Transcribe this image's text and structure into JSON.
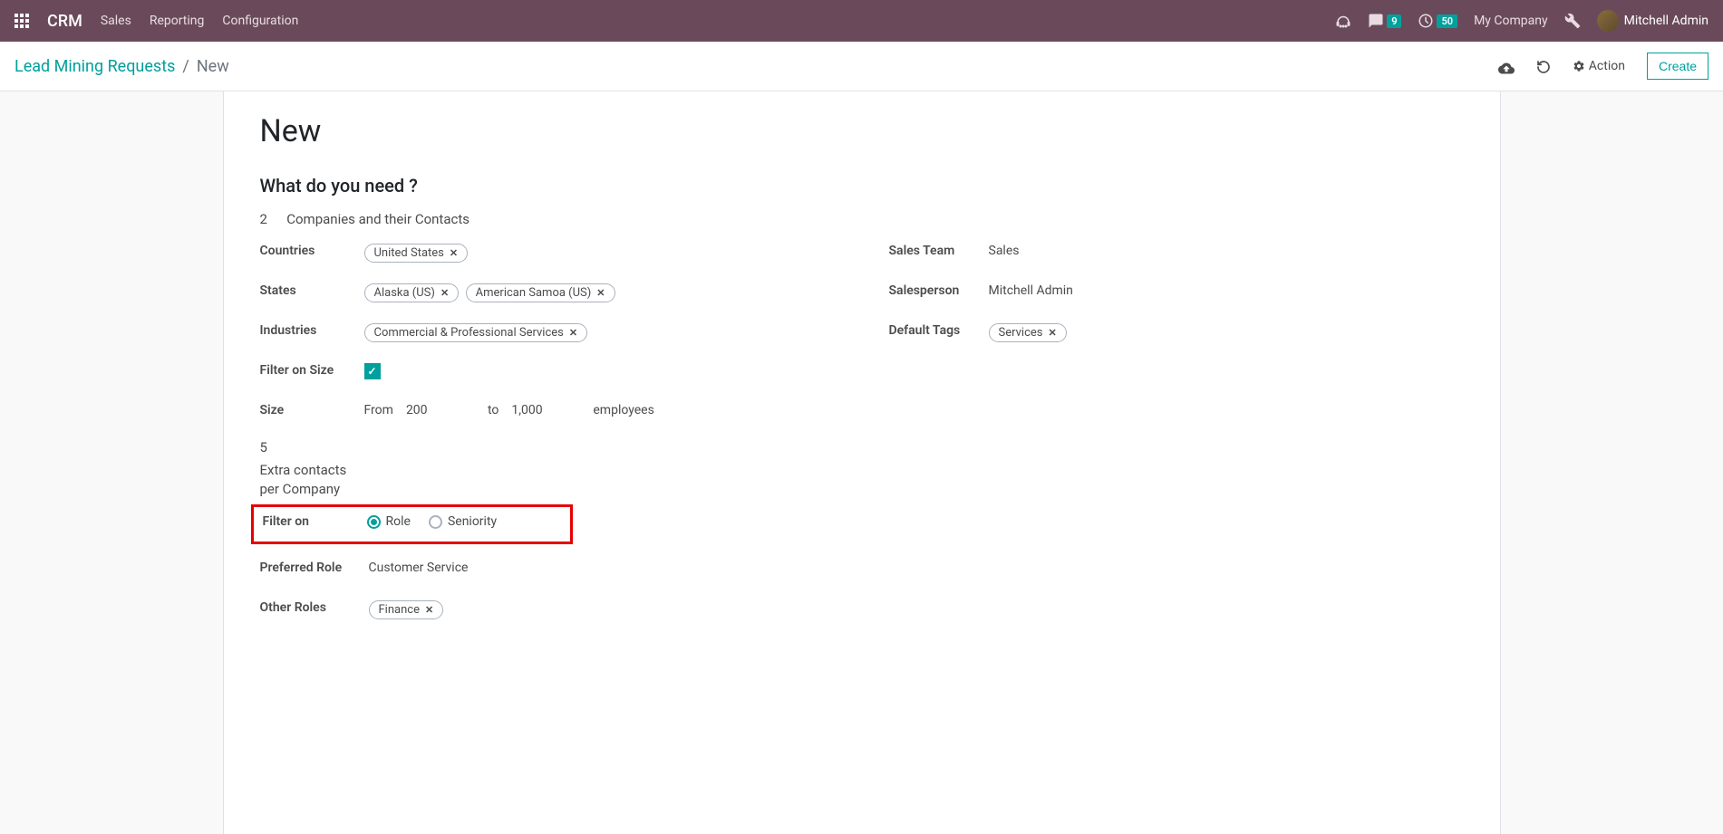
{
  "navbar": {
    "app_title": "CRM",
    "menu": [
      "Sales",
      "Reporting",
      "Configuration"
    ],
    "messages_badge": "9",
    "activities_badge": "50",
    "company": "My Company",
    "user": "Mitchell Admin"
  },
  "control_bar": {
    "breadcrumb_parent": "Lead Mining Requests",
    "breadcrumb_current": "New",
    "action_label": "Action",
    "create_label": "Create"
  },
  "form": {
    "title": "New",
    "section_title": "What do you need ?",
    "lead_count": "2",
    "lead_count_label": "Companies and their Contacts",
    "labels": {
      "countries": "Countries",
      "states": "States",
      "industries": "Industries",
      "filter_size": "Filter on Size",
      "size": "Size",
      "filter_on": "Filter on",
      "preferred_role": "Preferred Role",
      "other_roles": "Other Roles",
      "sales_team": "Sales Team",
      "salesperson": "Salesperson",
      "default_tags": "Default Tags"
    },
    "countries": [
      "United States"
    ],
    "states": [
      "Alaska (US)",
      "American Samoa (US)"
    ],
    "industries": [
      "Commercial & Professional Services"
    ],
    "filter_size_checked": true,
    "size": {
      "from_label": "From",
      "from": "200",
      "to_label": "to",
      "to": "1,000",
      "unit": "employees"
    },
    "extra_contacts": {
      "value": "5",
      "label": "Extra contacts per Company"
    },
    "filter_on": {
      "options": [
        "Role",
        "Seniority"
      ],
      "selected": "Role"
    },
    "preferred_role": "Customer Service",
    "other_roles": [
      "Finance"
    ],
    "sales_team": "Sales",
    "salesperson": "Mitchell Admin",
    "default_tags": [
      "Services"
    ]
  }
}
